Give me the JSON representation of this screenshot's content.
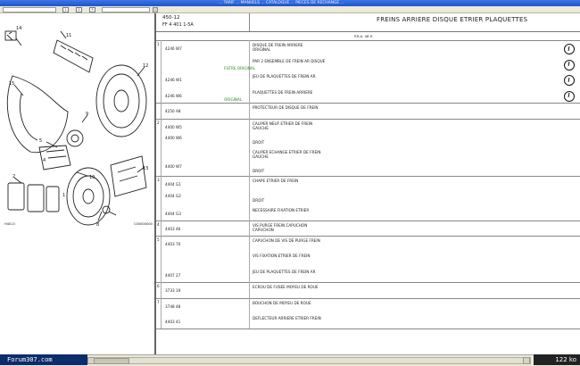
{
  "window": {
    "title": "... TARIF ... MANUELS ... CATALOGUE ... PIECES DE RECHANGE ..."
  },
  "toolbar": {
    "btn1": "1",
    "btn2": "2",
    "btn3": "3"
  },
  "diagram": {
    "ref_left": "H4013",
    "ref_right": "C00000000",
    "callouts": [
      "14",
      "11",
      "12",
      "15",
      "9",
      "5",
      "4",
      "10",
      "13",
      "8",
      "2",
      "1"
    ]
  },
  "header": {
    "code": "450-12",
    "subtitle": "FF 4 401 1-5A",
    "title": "FREINS ARRIERE DISQUE ETRIER PLAQUETTES"
  },
  "table": {
    "tab_label": "P.R.A. 48 H",
    "groups": [
      {
        "num": "1",
        "rows": [
          {
            "ref": "4246 W7",
            "text": "DISQUE DE FREIN ARRIERE",
            "note": "ORIGINAL",
            "green": "",
            "clock": true
          },
          {
            "ref": "",
            "text": "PAR 2 ENSEMBLE DE FREIN AR DISQUE",
            "note": "",
            "green": "FILTRE ORIGINAL",
            "clock": true
          },
          {
            "ref": "4246 W1",
            "text": "JEU DE PLAQUETTES DE FREIN AR",
            "note": "",
            "green": "",
            "clock": true
          },
          {
            "ref": "4246 W6",
            "text": "PLAQUETTES DE FREIN ARRIERE",
            "note": "",
            "green": "ORIGINAL",
            "clock": true
          }
        ]
      },
      {
        "num": "",
        "rows": [
          {
            "ref": "4250 A8",
            "text": "PROTECTEUR DE DISQUE DE FREIN",
            "note": "",
            "green": "",
            "clock": false
          }
        ]
      },
      {
        "num": "2",
        "rows": [
          {
            "ref": "4400 W5",
            "text": "CALIPER NEUF ETRIER DE FREIN",
            "note": "GAUCHE",
            "green": "",
            "clock": false
          },
          {
            "ref": "4400 W6",
            "text": "",
            "note": "DROIT",
            "green": "",
            "clock": false
          },
          {
            "ref": "",
            "text": "CALIPER ECHANGE ETRIER DE FREIN",
            "note": "GAUCHE",
            "green": "",
            "clock": false
          },
          {
            "ref": "4400 W7",
            "text": "",
            "note": "DROIT",
            "green": "",
            "clock": false
          }
        ]
      },
      {
        "num": "3",
        "rows": [
          {
            "ref": "4404 G1",
            "text": "CHAPE ETRIER DE FREIN",
            "note": "",
            "green": "",
            "clock": false
          },
          {
            "ref": "4404 G2",
            "text": "",
            "note": "DROIT",
            "green": "",
            "clock": false
          },
          {
            "ref": "4404 G3",
            "text": "NECESSAIRE FIXATION ETRIER",
            "note": "",
            "green": "",
            "clock": false
          }
        ]
      },
      {
        "num": "4",
        "rows": [
          {
            "ref": "4403 46",
            "text": "VIS PURGE FREIN CAPUCHON",
            "note": "CAPUCHON",
            "green": "",
            "clock": false
          }
        ]
      },
      {
        "num": "5",
        "rows": [
          {
            "ref": "4403 70",
            "text": "CAPUCHON DE VIS DE PURGE FREIN",
            "note": "",
            "green": "",
            "clock": false
          },
          {
            "ref": "",
            "text": "VIS FIXATION ETRIER DE FREIN",
            "note": "",
            "green": "",
            "clock": false
          },
          {
            "ref": "4407 27",
            "text": "JEU DE PLAQUETTES DE FREIN AR",
            "note": "",
            "green": "",
            "clock": false
          }
        ]
      },
      {
        "num": "6",
        "rows": [
          {
            "ref": "3733 19",
            "text": "ECROU DE FUSEE MOYEU DE ROUE",
            "note": "",
            "green": "",
            "clock": false
          }
        ]
      },
      {
        "num": "7",
        "rows": [
          {
            "ref": "3748 48",
            "text": "BOUCHON DE MOYEU DE ROUE",
            "note": "",
            "green": "",
            "clock": false
          },
          {
            "ref": "4403 41",
            "text": "DEFLECTEUR ARRIERE ETRIER FREIN",
            "note": "",
            "green": "",
            "clock": false
          }
        ]
      }
    ]
  },
  "status": {
    "site": "Forum307.com",
    "size": "122 ko"
  }
}
